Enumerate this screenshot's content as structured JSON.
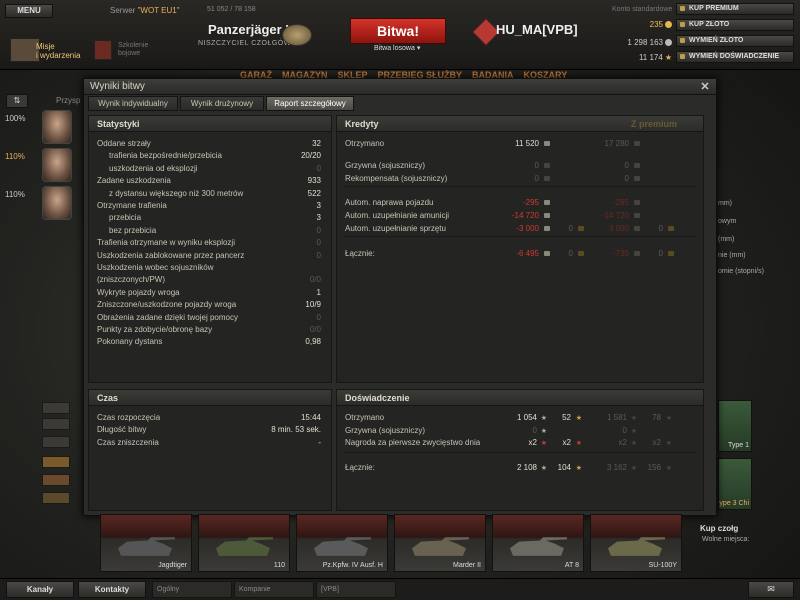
{
  "topbar": {
    "menu_label": "MENU",
    "server_label": "Serwer",
    "server_name": "\"WOT EU1\"",
    "online_count": "51 052 / 78 158",
    "missions_label_1": "Misje",
    "missions_label_2": "i wydarzenia",
    "school_label_1": "Szkolenie",
    "school_label_2": "bojowe",
    "player_name": "Panzerjäger I",
    "player_rank": "NISZCZYCIEL CZOŁGÓW",
    "battle_button": "Bitwa!",
    "battle_mode": "Bitwa losowa",
    "clan_tag": "HU_MA[VPB]",
    "account_type": "Konto standardowe",
    "gold": "235",
    "credits": "1 298 163",
    "free_xp": "11 174",
    "buy_premium": "KUP PREMIUM",
    "buy_gold": "KUP ZŁOTO",
    "exchange_gold": "WYMIEŃ ZŁOTO",
    "exchange_xp": "WYMIEŃ DOŚWIADCZENIE"
  },
  "nav": [
    "GARAŻ",
    "MAGAZYN",
    "SKLEP",
    "PRZEBIEG SŁUŻBY",
    "BADANIA",
    "KOSZARY"
  ],
  "left_panel": {
    "pct_1": "100%",
    "pct_2": "110%",
    "pct_3": "110%",
    "pct_4": "100%",
    "tab_label": "Przysp"
  },
  "dialog": {
    "title": "Wyniki bitwy",
    "tabs": [
      "Wynik indywidualny",
      "Wynik drużynowy",
      "Raport szczegółowy"
    ],
    "stats": {
      "header": "Statystyki",
      "rows": [
        {
          "label": "Oddane strzały",
          "value": "32"
        },
        {
          "label": "trafienia bezpośrednie/przebicia",
          "value": "20/20"
        },
        {
          "label": "uszkodzenia od eksplozji",
          "value": "0"
        },
        {
          "label": "Zadane uszkodzenia",
          "value": "933"
        },
        {
          "label": "z dystansu większego niż 300 metrów",
          "value": "522"
        },
        {
          "label": "Otrzymane trafienia",
          "value": "3"
        },
        {
          "label": "przebicia",
          "value": "3"
        },
        {
          "label": "bez przebicia",
          "value": "0"
        },
        {
          "label": "Trafienia otrzymane w wyniku eksplozji",
          "value": "0"
        },
        {
          "label": "Uszkodzenia zablokowane przez pancerz",
          "value": "0"
        },
        {
          "label": "Uszkodzenia wobec sojuszników",
          "value": ""
        },
        {
          "label": "(zniszczonych/PW)",
          "value": "0/0"
        },
        {
          "label": "Wykryte pojazdy wroga",
          "value": "1"
        },
        {
          "label": "Zniszczone/uszkodzone pojazdy wroga",
          "value": "10/9"
        },
        {
          "label": "Obrażenia zadane dzięki twojej pomocy",
          "value": "0"
        },
        {
          "label": "Punkty za zdobycie/obronę bazy",
          "value": "0/0"
        },
        {
          "label": "Pokonany dystans",
          "value": "0,98"
        }
      ]
    },
    "credits": {
      "header": "Kredyty",
      "premium_header": "Z premium",
      "rows": [
        {
          "label": "Otrzymano",
          "v1": "11 520",
          "v2": "",
          "p1": "17 280",
          "p2": ""
        },
        {
          "label": "Grzywna (sojuszniczy)",
          "v1": "0",
          "v2": "",
          "p1": "0",
          "p2": ""
        },
        {
          "label": "Rekompensata (sojuszniczy)",
          "v1": "0",
          "v2": "",
          "p1": "0",
          "p2": ""
        },
        {
          "label": "Autom. naprawa pojazdu",
          "v1": "-295",
          "v2": "",
          "p1": "-295",
          "p2": ""
        },
        {
          "label": "Autom. uzupełnianie amunicji",
          "v1": "-14 720",
          "v2": "",
          "p1": "-14 720",
          "p2": ""
        },
        {
          "label": "Autom. uzupełnianie sprzętu",
          "v1": "-3 000",
          "v2": "0",
          "p1": "-3 000",
          "p2": "0"
        },
        {
          "label": "Łącznie:",
          "v1": "-6 495",
          "v2": "0",
          "p1": "-735",
          "p2": "0"
        }
      ]
    },
    "time": {
      "header": "Czas",
      "rows": [
        {
          "label": "Czas rozpoczęcia",
          "value": "15:44"
        },
        {
          "label": "Długość bitwy",
          "value": "8 min. 53 sek."
        },
        {
          "label": "Czas zniszczenia",
          "value": "-"
        }
      ]
    },
    "experience": {
      "header": "Doświadczenie",
      "rows": [
        {
          "label": "Otrzymano",
          "v1": "1 054",
          "v2": "52",
          "p1": "1 581",
          "p2": "78"
        },
        {
          "label": "Grzywna (sojuszniczy)",
          "v1": "0",
          "v2": "",
          "p1": "0",
          "p2": ""
        },
        {
          "label": "Nagroda za pierwsze zwycięstwo dnia",
          "v1": "x2",
          "v2": "x2",
          "p1": "x2",
          "p2": "x2"
        },
        {
          "label": "Łącznie:",
          "v1": "2 108",
          "v2": "104",
          "p1": "3 162",
          "p2": "156"
        }
      ]
    }
  },
  "carousel": {
    "tanks": [
      "Jagdtiger",
      "110",
      "Pz.Kpfw. IV Ausf. H",
      "Marder II",
      "AT 8",
      "SU-100Y"
    ],
    "buy_slot": "Kup czołg",
    "buy_slot_sub": "Wolne miejsca:"
  },
  "right_partial": {
    "l1": "mm)",
    "l2": "owym",
    "l3": "(mm)",
    "l4": "nie (mm)",
    "l5": "omie (stopni/s)",
    "type1": "Type 1",
    "type3": "ype 3 Chi"
  },
  "bottombar": {
    "channels": "Kanały",
    "contacts": "Kontakty",
    "tab_general": "Ogólny",
    "tab_company": "Kompanie",
    "tab_clan": "[VPB]"
  }
}
